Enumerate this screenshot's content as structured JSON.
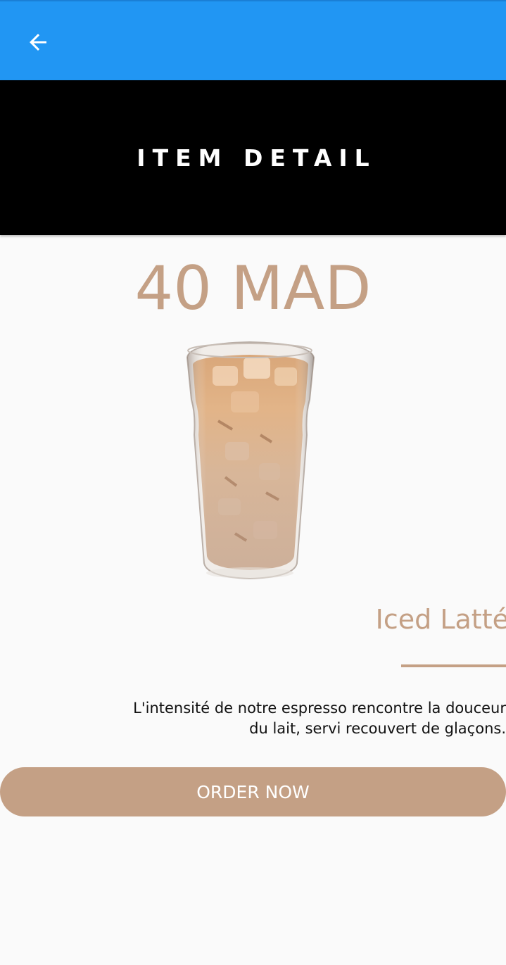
{
  "app_bar": {
    "back_icon": "arrow-back-icon",
    "color": "#2196f3"
  },
  "banner": {
    "title": "ITEM DETAIL",
    "background": "#000000"
  },
  "item": {
    "price": "40 MAD",
    "name": "Iced Latté",
    "image_icon": "iced-latte-glass",
    "description": "L'intensité de notre espresso rencontre la douceur du lait, servi recouvert de glaçons.",
    "accent_color": "#c4a085"
  },
  "actions": {
    "order_label": "ORDER NOW"
  }
}
